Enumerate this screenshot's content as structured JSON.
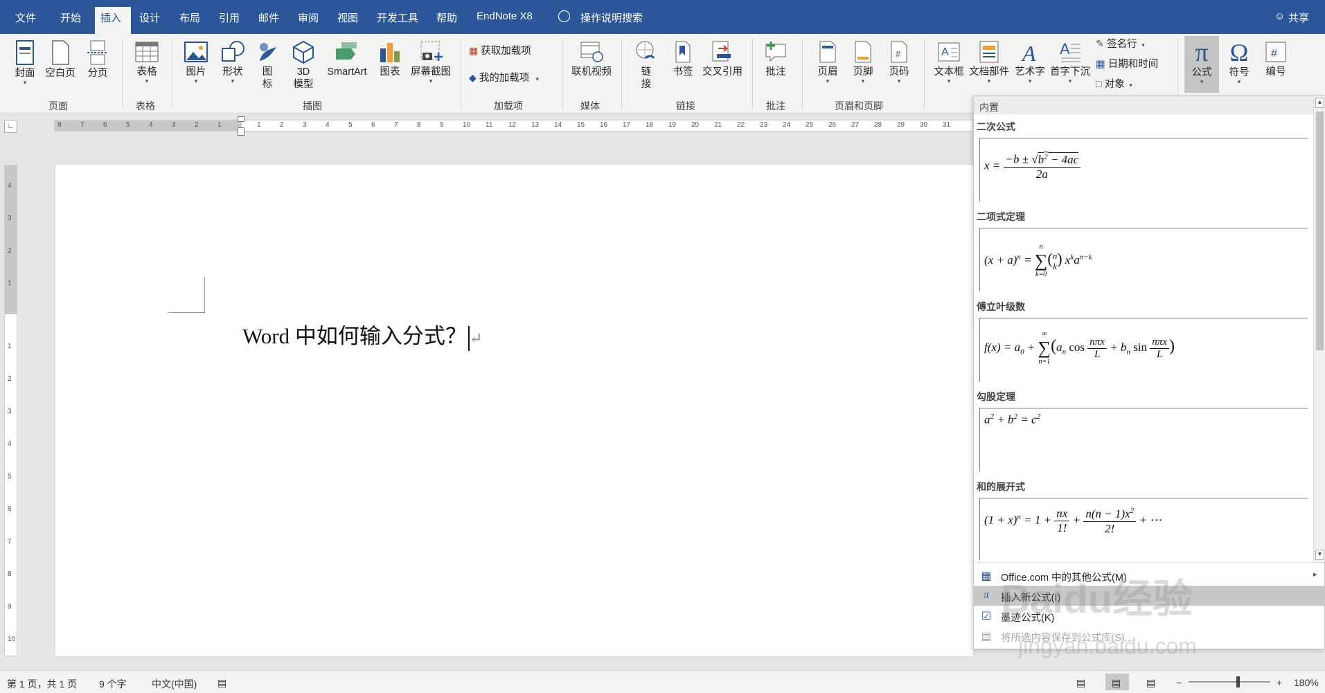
{
  "menu": {
    "tabs": [
      "文件",
      "开始",
      "插入",
      "设计",
      "布局",
      "引用",
      "邮件",
      "审阅",
      "视图",
      "开发工具",
      "帮助",
      "EndNote X8"
    ],
    "search_label": "操作说明搜索",
    "share_label": "共享"
  },
  "ribbon": {
    "cover": "封面",
    "blank_page": "空白页",
    "page_break": "分页",
    "table": "表格",
    "picture": "图片",
    "shapes": "形状",
    "icons_1": "图",
    "icons_2": "标",
    "model3d_1": "3D",
    "model3d_2": "模型",
    "smartart": "SmartArt",
    "chart": "图表",
    "screenshot": "屏幕截图",
    "get_addins": "获取加载项",
    "my_addins": "我的加载项",
    "online_video": "联机视频",
    "link_1": "链",
    "link_2": "接",
    "bookmark": "书签",
    "cross_ref": "交叉引用",
    "comment": "批注",
    "header": "页眉",
    "footer": "页脚",
    "page_number": "页码",
    "textbox": "文本框",
    "quick_parts": "文档部件",
    "wordart": "艺术字",
    "dropcap": "首字下沉",
    "signature_line": "签名行",
    "date_time": "日期和时间",
    "object": "对象",
    "equation": "公式",
    "symbol": "符号",
    "numbering": "编号",
    "groups": {
      "pages": "页面",
      "tables": "表格",
      "illustrations": "插图",
      "addins": "加载项",
      "media": "媒体",
      "links": "链接",
      "comments": "批注",
      "header_footer": "页眉和页脚"
    }
  },
  "ruler": {
    "h_left": [
      "8",
      "7",
      "6",
      "5",
      "4",
      "3",
      "2",
      "1"
    ],
    "h_right": [
      "1",
      "2",
      "3",
      "4",
      "5",
      "6",
      "7",
      "8",
      "9",
      "10",
      "11",
      "12",
      "13",
      "14",
      "15",
      "16",
      "17",
      "18",
      "19",
      "20",
      "21",
      "22",
      "23",
      "24",
      "25",
      "26",
      "27",
      "28",
      "29",
      "30",
      "31"
    ],
    "v_top": [
      "4",
      "3",
      "2",
      "1"
    ],
    "v_bottom": [
      "1",
      "2",
      "3",
      "4",
      "5",
      "6",
      "7",
      "8",
      "9",
      "10"
    ]
  },
  "document": {
    "text": "Word 中如何输入分式？"
  },
  "equation_panel": {
    "header": "内置",
    "items": [
      {
        "title": "二次公式"
      },
      {
        "title": "二项式定理"
      },
      {
        "title": "傅立叶级数"
      },
      {
        "title": "勾股定理"
      },
      {
        "title": "和的展开式"
      }
    ],
    "menu": [
      "Office.com 中的其他公式(M)",
      "插入新公式(I)",
      "墨迹公式(K)",
      "将所选内容保存到公式库(S)..."
    ]
  },
  "status": {
    "page": "第 1 页，共 1 页",
    "words": "9 个字",
    "language": "中文(中国)",
    "zoom": "180%"
  },
  "watermark": {
    "main": "Baidu经验",
    "sub": "jingyan.baidu.com"
  },
  "colors": {
    "accent": "#2b579a",
    "ribbon": "#f3f3f3"
  }
}
